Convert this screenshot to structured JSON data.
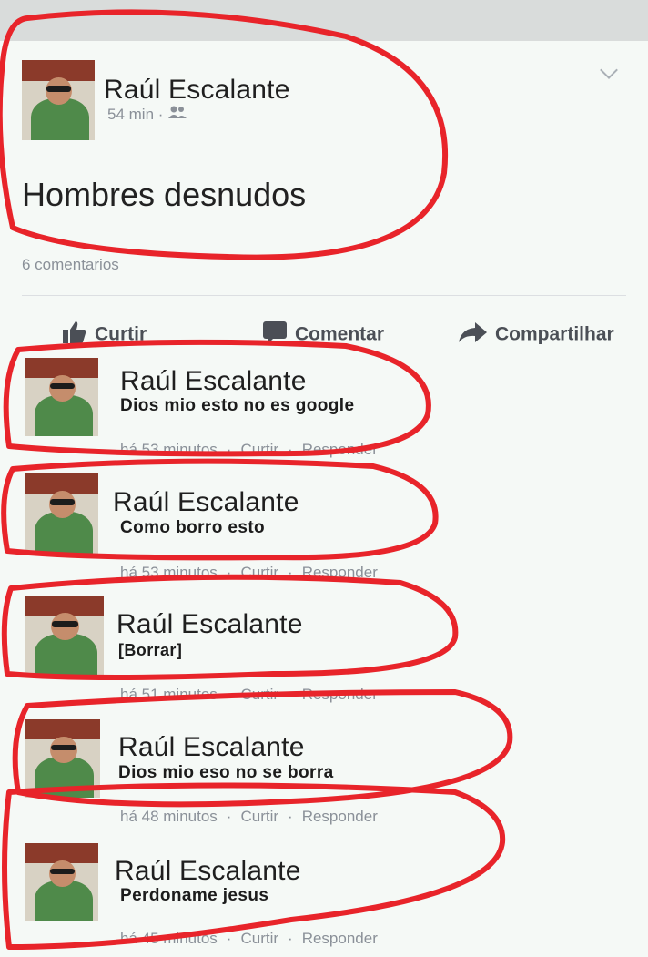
{
  "post": {
    "author": "Raúl Escalante",
    "time": "54 min",
    "text": "Hombres desnudos",
    "comment_count": "6 comentarios"
  },
  "actions": {
    "like": "Curtir",
    "comment": "Comentar",
    "share": "Compartilhar"
  },
  "comments": [
    {
      "author": "Raúl Escalante",
      "text": "Dios mio esto no es google",
      "time": "há 53 minutos",
      "like": "Curtir",
      "reply": "Responder"
    },
    {
      "author": "Raúl Escalante",
      "text": "Como borro esto",
      "time": "há 53 minutos",
      "like": "Curtir",
      "reply": "Responder"
    },
    {
      "author": "Raúl Escalante",
      "text": "[Borrar]",
      "time": "há 51 minutos",
      "like": "Curtir",
      "reply": "Responder"
    },
    {
      "author": "Raúl Escalante",
      "text": "Dios mio eso no se borra",
      "time": "há 48 minutos",
      "like": "Curtir",
      "reply": "Responder"
    },
    {
      "author": "Raúl Escalante",
      "text": "Perdoname jesus",
      "time": "há 45 minutos",
      "like": "Curtir",
      "reply": "Responder"
    }
  ],
  "colors": {
    "annotation_red": "#e8242a",
    "background": "#f5f9f6",
    "meta_gray": "#8a9098"
  }
}
